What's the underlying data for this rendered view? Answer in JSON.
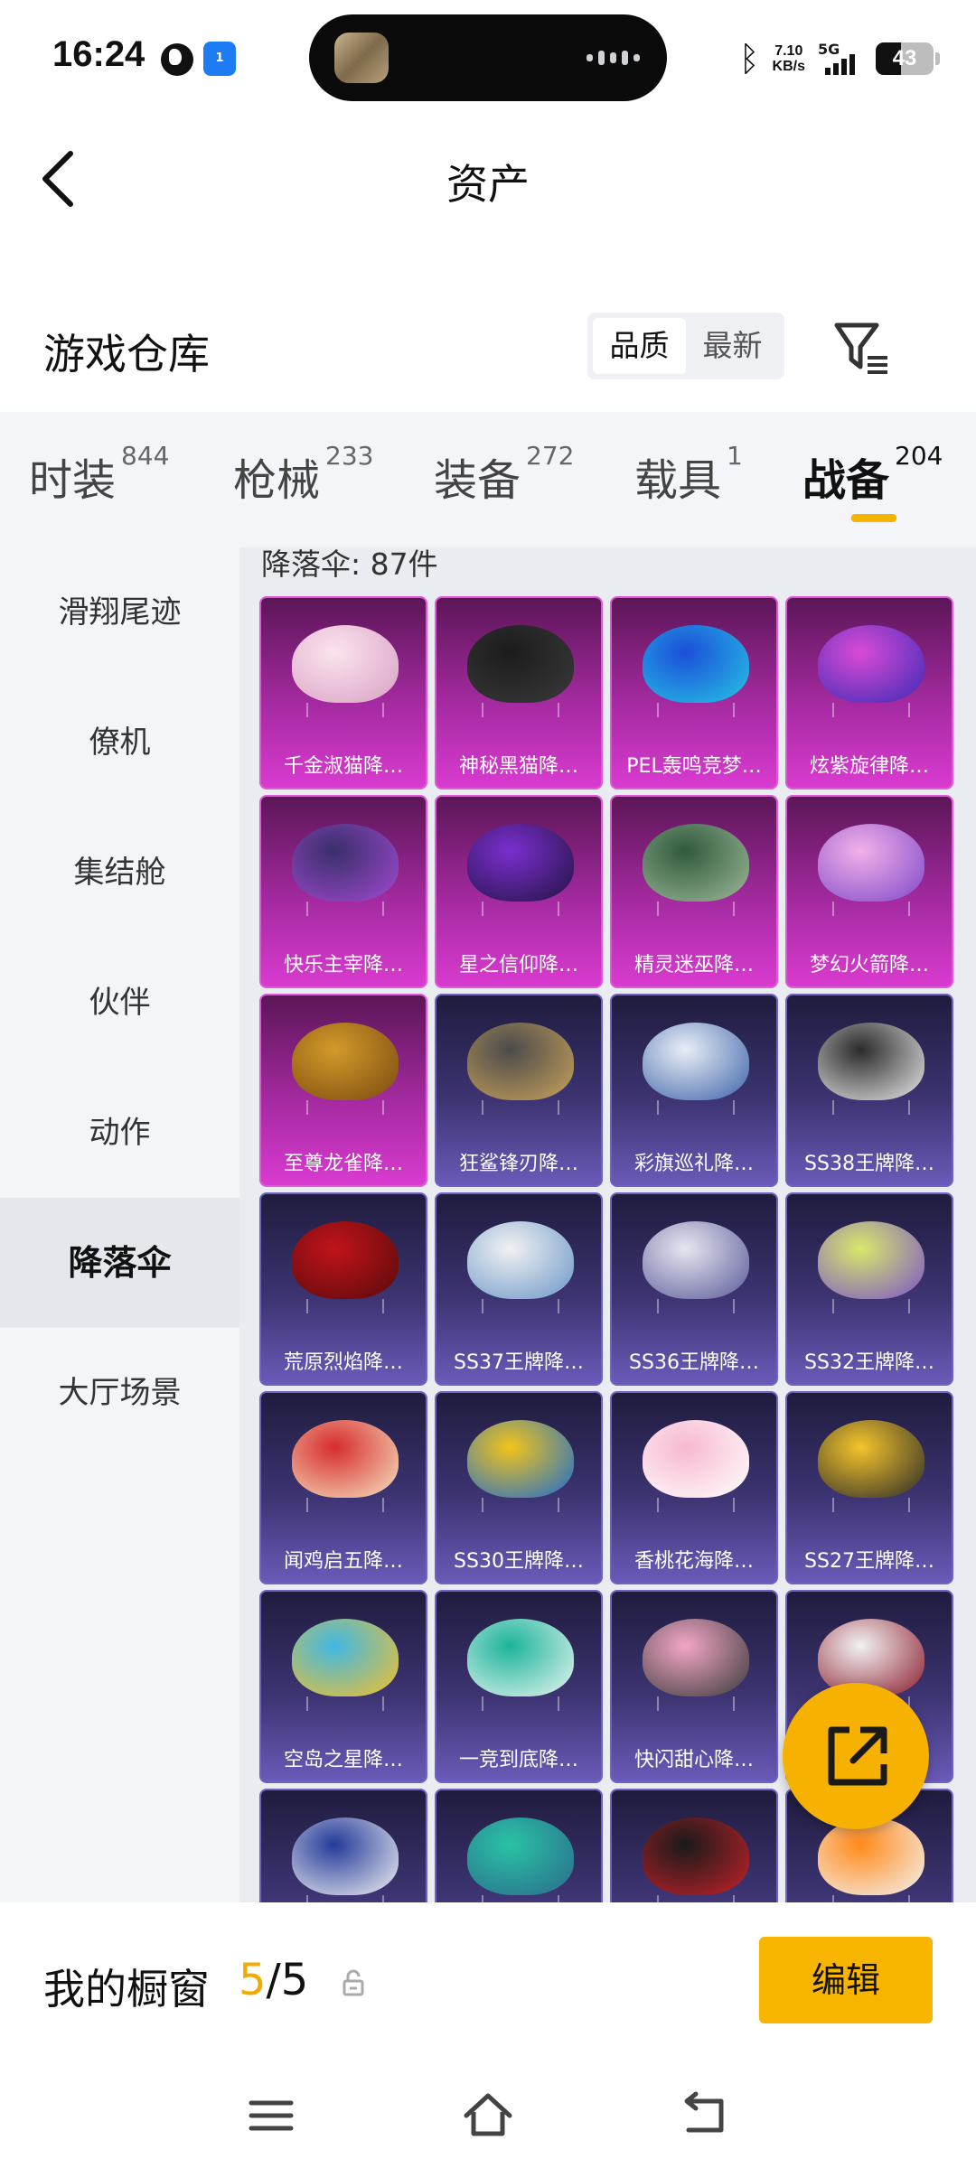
{
  "status_bar": {
    "time": "16:24",
    "speed_value": "7.10",
    "speed_unit": "KB/s",
    "network": "5G",
    "battery": "43",
    "battery_level": 0.43,
    "hotspot_badge": "1",
    "icons": [
      "globe-icon",
      "hotspot-icon",
      "bluetooth-icon",
      "signal-icon",
      "battery-icon"
    ]
  },
  "header": {
    "title": "资产"
  },
  "warehouse": {
    "title": "游戏仓库",
    "sort": [
      "品质",
      "最新"
    ],
    "sort_selected": "品质"
  },
  "categories": [
    {
      "label": "时装",
      "count": "844"
    },
    {
      "label": "枪械",
      "count": "233"
    },
    {
      "label": "装备",
      "count": "272"
    },
    {
      "label": "载具",
      "count": "1"
    },
    {
      "label": "战备",
      "count": "204",
      "active": true
    }
  ],
  "side_nav": [
    {
      "label": "滑翔尾迹"
    },
    {
      "label": "僚机"
    },
    {
      "label": "集结舱"
    },
    {
      "label": "伙伴"
    },
    {
      "label": "动作"
    },
    {
      "label": "降落伞",
      "active": true
    },
    {
      "label": "大厅场景"
    }
  ],
  "content": {
    "count_label": "降落伞: 87件",
    "items": [
      {
        "name": "千金淑猫降…",
        "tier": "pink",
        "colors": [
          "#fbe3ee",
          "#d9a1c4"
        ]
      },
      {
        "name": "神秘黑猫降…",
        "tier": "pink",
        "colors": [
          "#1c1c1c",
          "#3a3a3a"
        ]
      },
      {
        "name": "PEL轰鸣竞梦…",
        "tier": "pink",
        "colors": [
          "#1b4fd8",
          "#27c3e6"
        ]
      },
      {
        "name": "炫紫旋律降…",
        "tier": "pink",
        "colors": [
          "#d94bd6",
          "#3b2bb6"
        ]
      },
      {
        "name": "快乐主宰降…",
        "tier": "pink",
        "colors": [
          "#3a2f6b",
          "#a14ad1"
        ]
      },
      {
        "name": "星之信仰降…",
        "tier": "pink",
        "colors": [
          "#7a2fd0",
          "#241342"
        ]
      },
      {
        "name": "精灵迷巫降…",
        "tier": "pink",
        "colors": [
          "#2f5a3c",
          "#9fb89a"
        ]
      },
      {
        "name": "梦幻火箭降…",
        "tier": "pink",
        "colors": [
          "#f3b0e8",
          "#7d49c9"
        ]
      },
      {
        "name": "至尊龙雀降…",
        "tier": "pink",
        "colors": [
          "#d39a2a",
          "#7a4a10"
        ]
      },
      {
        "name": "狂鲨锋刃降…",
        "tier": "blue",
        "colors": [
          "#4b4b4b",
          "#c9a25a"
        ]
      },
      {
        "name": "彩旗巡礼降…",
        "tier": "blue",
        "colors": [
          "#e8eef6",
          "#3d63a8"
        ]
      },
      {
        "name": "SS38王牌降…",
        "tier": "blue",
        "colors": [
          "#2b2b2b",
          "#e9e9e9"
        ]
      },
      {
        "name": "荒原烈焰降…",
        "tier": "blue",
        "colors": [
          "#c0141b",
          "#5a0a0a"
        ]
      },
      {
        "name": "SS37王牌降…",
        "tier": "blue",
        "colors": [
          "#f1f1f1",
          "#6a96c9"
        ]
      },
      {
        "name": "SS36王牌降…",
        "tier": "blue",
        "colors": [
          "#e6e6ef",
          "#5a5a9a"
        ]
      },
      {
        "name": "SS32王牌降…",
        "tier": "blue",
        "colors": [
          "#d8e86a",
          "#7b53c9"
        ]
      },
      {
        "name": "闻鸡启五降…",
        "tier": "blue",
        "colors": [
          "#d62c2c",
          "#f6e4c2"
        ]
      },
      {
        "name": "SS30王牌降…",
        "tier": "blue",
        "colors": [
          "#f2c41a",
          "#1a6bd0"
        ]
      },
      {
        "name": "香桃花海降…",
        "tier": "blue",
        "colors": [
          "#f7b8cf",
          "#ffffff"
        ]
      },
      {
        "name": "SS27王牌降…",
        "tier": "blue",
        "colors": [
          "#f4c42a",
          "#2a2a2a"
        ]
      },
      {
        "name": "空岛之星降…",
        "tier": "blue",
        "colors": [
          "#3fb8e4",
          "#f5c02a"
        ]
      },
      {
        "name": "一竞到底降…",
        "tier": "blue",
        "colors": [
          "#1cb49a",
          "#e9f5f0"
        ]
      },
      {
        "name": "快闪甜心降…",
        "tier": "blue",
        "colors": [
          "#f2a6c6",
          "#3a3a3a"
        ]
      },
      {
        "name": "",
        "tier": "blue",
        "colors": [
          "#f2f2f2",
          "#8a1a2a"
        ]
      },
      {
        "name": "",
        "tier": "blue",
        "colors": [
          "#243a9a",
          "#f2f2f2"
        ]
      },
      {
        "name": "",
        "tier": "blue",
        "colors": [
          "#29c2a6",
          "#2b6b8a"
        ]
      },
      {
        "name": "",
        "tier": "blue",
        "colors": [
          "#1a1a1a",
          "#c4222a"
        ]
      },
      {
        "name": "",
        "tier": "blue",
        "colors": [
          "#ff8a1a",
          "#f4f4f4"
        ]
      }
    ]
  },
  "showcase": {
    "label": "我的橱窗",
    "current": "5",
    "total": "/5",
    "edit_label": "编辑"
  },
  "colors": {
    "accent": "#f7b500",
    "pink_tier": "#a42aa0",
    "blue_tier": "#3d3472"
  }
}
